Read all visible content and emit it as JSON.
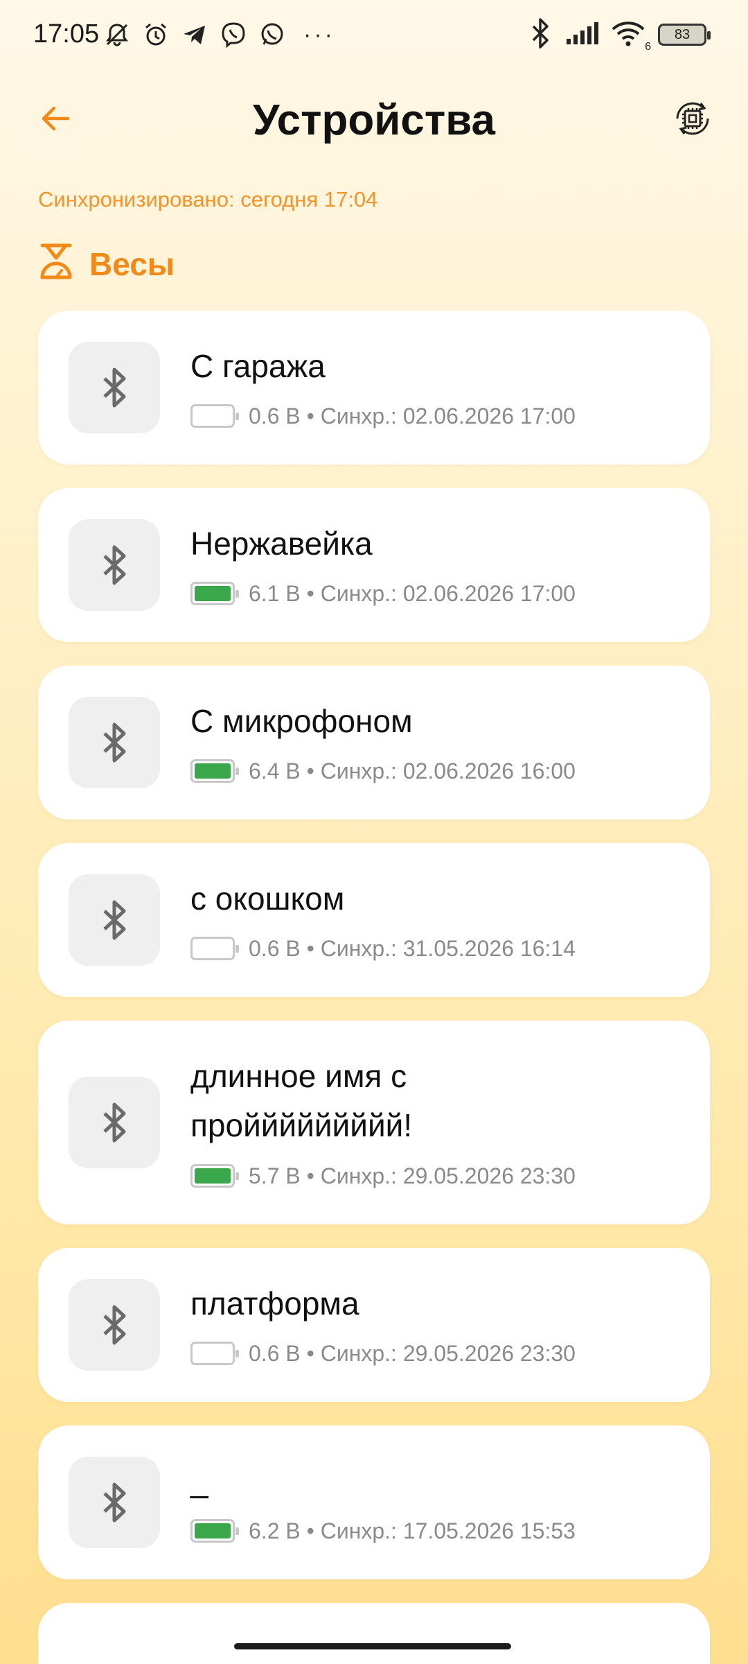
{
  "status_bar": {
    "time": "17:05",
    "left_icons": [
      "mute-notifications-icon",
      "alarm-icon",
      "telegram-icon",
      "viber-icon",
      "whatsapp-icon"
    ],
    "more": "···",
    "right_icons": [
      "bluetooth-icon",
      "signal-icon",
      "wifi-icon"
    ],
    "wifi_badge": "6",
    "battery": "83"
  },
  "header": {
    "title": "Устройства",
    "back_icon": "arrow-left-icon",
    "action_icon": "chip-sync-icon"
  },
  "sync_status": "Синхронизировано: сегодня 17:04",
  "section": {
    "title": "Весы",
    "icon": "scale-icon"
  },
  "colors": {
    "accent": "#f28a17",
    "sync_text": "#f0952b",
    "battery_ok": "#3aa84a"
  },
  "devices": [
    {
      "name": "С гаража",
      "name_line2": "",
      "battery_level": 0.0,
      "meta": "0.6 В • Синхр.: 02.06.2026 17:00"
    },
    {
      "name": "Нержавейка",
      "name_line2": "",
      "battery_level": 1.0,
      "meta": "6.1 В • Синхр.: 02.06.2026 17:00"
    },
    {
      "name": "С микрофоном",
      "name_line2": "",
      "battery_level": 1.0,
      "meta": "6.4 В • Синхр.: 02.06.2026 16:00"
    },
    {
      "name": "с окошком",
      "name_line2": "",
      "battery_level": 0.0,
      "meta": "0.6 В • Синхр.: 31.05.2026 16:14"
    },
    {
      "name": "длинное имя с",
      "name_line2": "проййййййййй!",
      "battery_level": 1.0,
      "meta": "5.7 В • Синхр.: 29.05.2026 23:30"
    },
    {
      "name": "платформа",
      "name_line2": "",
      "battery_level": 0.0,
      "meta": "0.6 В • Синхр.: 29.05.2026 23:30"
    },
    {
      "name": "_",
      "name_line2": "",
      "battery_level": 1.0,
      "meta": "6.2 В • Синхр.: 17.05.2026 15:53"
    }
  ]
}
